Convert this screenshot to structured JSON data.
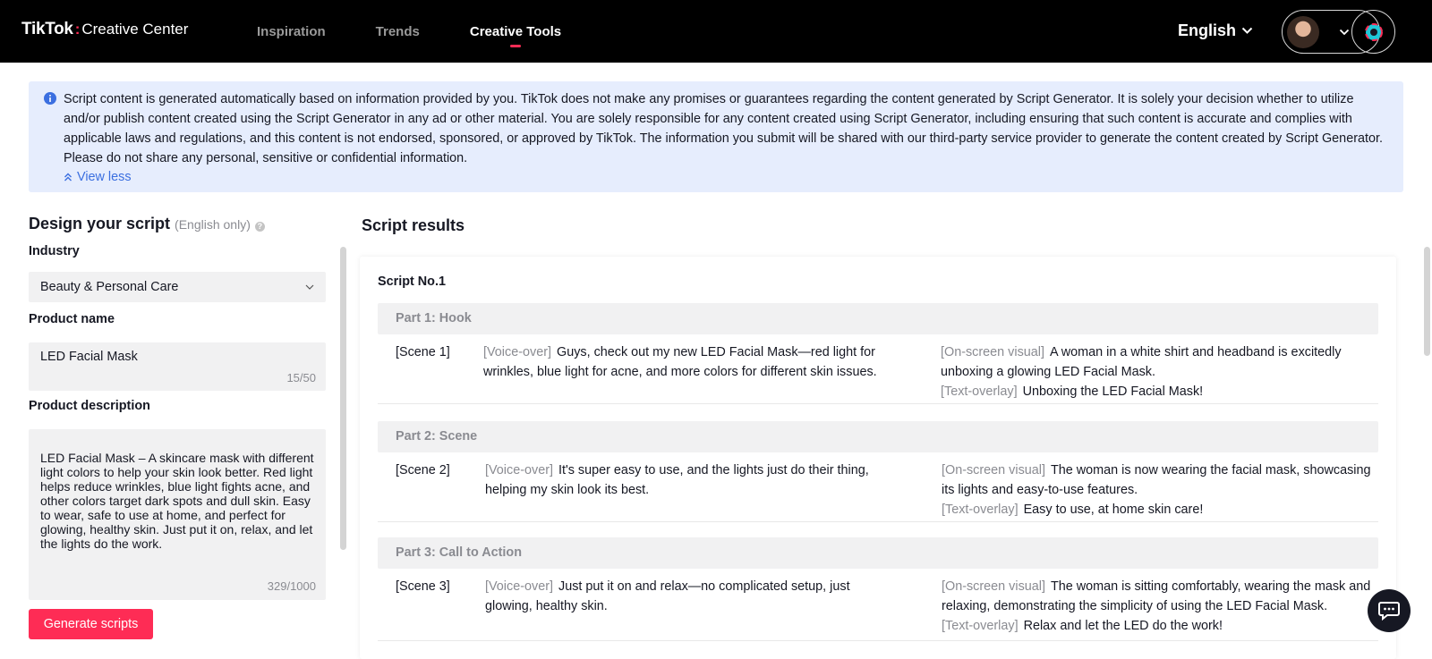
{
  "nav": {
    "logo_brand": "TikTok",
    "logo_separator": ":",
    "logo_product": "Creative Center",
    "items": [
      {
        "label": "Inspiration",
        "active": false
      },
      {
        "label": "Trends",
        "active": false
      },
      {
        "label": "Creative Tools",
        "active": true
      }
    ],
    "language": "English"
  },
  "notice": {
    "text": "Script content is generated automatically based on information provided by you. TikTok does not make any promises or guarantees regarding the content generated by Script Generator. It is solely your decision whether to utilize and/or publish content created using the Script Generator in any ad or other material. You are solely responsible for any content created using Script Generator, including ensuring that such content is accurate and complies with applicable laws and regulations, and this content is not endorsed, sponsored, or approved by TikTok. The information you submit will be shared with our third-party service provider to generate the content created by Script Generator. Please do not share any personal, sensitive or confidential information.",
    "toggle_label": "View less"
  },
  "design": {
    "title": "Design your script",
    "note": "(English only)",
    "industry_label": "Industry",
    "industry_value": "Beauty & Personal Care",
    "product_name_label": "Product name",
    "product_name_value": "LED Facial Mask",
    "product_name_counter": "15/50",
    "product_desc_label": "Product description",
    "product_desc_value": "LED Facial Mask – A skincare mask with different light colors to help your skin look better. Red light helps reduce wrinkles, blue light fights acne, and other colors target dark spots and dull skin. Easy to wear, safe to use at home, and perfect for glowing, healthy skin. Just put it on, relax, and let the lights do the work.",
    "product_desc_counter": "329/1000",
    "generate_label": "Generate scripts"
  },
  "results": {
    "title": "Script results",
    "script_no": "Script No.1",
    "tags": {
      "voice_over": "[Voice-over]",
      "visual": "[On-screen visual]",
      "overlay": "[Text-overlay]"
    },
    "parts": [
      {
        "heading": "Part 1: Hook",
        "scene": "[Scene 1]",
        "voice_over": "Guys, check out my new LED Facial Mask—red light for wrinkles, blue light for acne, and more colors for different skin issues.",
        "visual": "A woman in a white shirt and headband is excitedly unboxing a glowing LED Facial Mask.",
        "overlay": "Unboxing the LED Facial Mask!"
      },
      {
        "heading": "Part 2: Scene",
        "scene": "[Scene 2]",
        "voice_over": "It's super easy to use, and the lights just do their thing, helping my skin look its best.",
        "visual": "The woman is now wearing the facial mask, showcasing its lights and easy-to-use features.",
        "overlay": "Easy to use, at home skin care!"
      },
      {
        "heading": "Part 3: Call to Action",
        "scene": "[Scene 3]",
        "voice_over": "Just put it on and relax—no complicated setup, just glowing, healthy skin.",
        "visual": "The woman is sitting comfortably, wearing the mask and relaxing, demonstrating the simplicity of using the LED Facial Mask.",
        "overlay": "Relax and let the LED do the work!"
      }
    ]
  },
  "icons": {
    "info": "info-icon",
    "chevron": "chevron-down-icon",
    "double_up": "double-chevron-up-icon",
    "help": "help-icon",
    "chat": "chat-icon",
    "logout": "logout-icon"
  },
  "colors": {
    "accent": "#fe2c55",
    "link": "#3b6fe0",
    "notice_bg": "#e6edfd"
  }
}
